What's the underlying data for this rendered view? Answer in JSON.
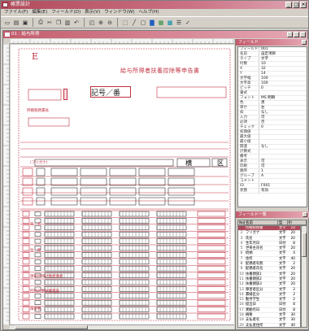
{
  "window": {
    "title": "帳票設計",
    "child_title": "01 : 給与所得"
  },
  "menu": [
    "ファイル(F)",
    "編集(E)",
    "フィールド(D)",
    "表示(V)",
    "ウィンドウ(W)",
    "ヘルプ(H)"
  ],
  "toolbar_icons": [
    "new-icon",
    "open-icon",
    "save-icon",
    "print-icon",
    "cut-icon",
    "copy-icon",
    "paste-icon",
    "undo-icon",
    "preview-icon",
    "zoom-in-icon",
    "zoom-out-icon",
    "field-icon",
    "line-icon",
    "box-icon",
    "text-icon",
    "grid-icon",
    "property-icon",
    "list-icon",
    "check-icon"
  ],
  "form": {
    "big_letter": "E",
    "title": "給与所得者扶養控除等申告書",
    "kanji_field": "記号／番",
    "label_left": "所轄税務署長",
    "row_labels": [
      "(フリガナ)",
      "氏　名",
      "住　所",
      "源泉控除対象配偶者",
      "控除対象扶養親族",
      "障害者"
    ],
    "thumb_chars": [
      "横",
      "区"
    ]
  },
  "properties": {
    "title": "フィールド",
    "rows": [
      {
        "k": "フィールド",
        "v": "001"
      },
      {
        "k": "名前",
        "v": "設定項目"
      },
      {
        "k": "タイプ",
        "v": "文字"
      },
      {
        "k": "桁数",
        "v": "10"
      },
      {
        "k": "X",
        "v": "32"
      },
      {
        "k": "Y",
        "v": "14"
      },
      {
        "k": "文字幅",
        "v": "100"
      },
      {
        "k": "文字高",
        "v": "100"
      },
      {
        "k": "ピッチ",
        "v": "0"
      },
      {
        "k": "書式",
        "v": ""
      },
      {
        "k": "フォント",
        "v": "MS 明朝"
      },
      {
        "k": "色",
        "v": "黒"
      },
      {
        "k": "寄せ",
        "v": "左"
      },
      {
        "k": "枠",
        "v": "なし"
      },
      {
        "k": "入力",
        "v": "可"
      },
      {
        "k": "必須",
        "v": "否"
      },
      {
        "k": "チェック",
        "v": "0"
      },
      {
        "k": "初期値",
        "v": ""
      },
      {
        "k": "最大値",
        "v": ""
      },
      {
        "k": "最小値",
        "v": ""
      },
      {
        "k": "関連",
        "v": "なし"
      },
      {
        "k": "計算式",
        "v": ""
      },
      {
        "k": "備考",
        "v": ""
      },
      {
        "k": "表示",
        "v": "可"
      },
      {
        "k": "印刷",
        "v": "可"
      },
      {
        "k": "順序",
        "v": "1"
      },
      {
        "k": "グループ",
        "v": "A"
      },
      {
        "k": "コメント",
        "v": ""
      },
      {
        "k": "ID",
        "v": "F001"
      },
      {
        "k": "状態",
        "v": "有効"
      }
    ]
  },
  "fieldlist": {
    "title": "フィールド一覧",
    "headers": [
      "No",
      "名前",
      "型",
      "桁"
    ],
    "rows": [
      {
        "n": "1",
        "name": "所轄税務署",
        "t": "文字",
        "w": "10"
      },
      {
        "n": "2",
        "name": "フリガナ",
        "t": "文字",
        "w": "20"
      },
      {
        "n": "3",
        "name": "氏名",
        "t": "文字",
        "w": "20"
      },
      {
        "n": "4",
        "name": "生年月日",
        "t": "日付",
        "w": "8"
      },
      {
        "n": "5",
        "name": "世帯主氏名",
        "t": "文字",
        "w": "20"
      },
      {
        "n": "6",
        "name": "続柄",
        "t": "文字",
        "w": "4"
      },
      {
        "n": "7",
        "name": "住所",
        "t": "文字",
        "w": "40"
      },
      {
        "n": "8",
        "name": "配偶者有無",
        "t": "文字",
        "w": "2"
      },
      {
        "n": "9",
        "name": "配偶者氏名",
        "t": "文字",
        "w": "20"
      },
      {
        "n": "10",
        "name": "扶養親族1",
        "t": "文字",
        "w": "20"
      },
      {
        "n": "11",
        "name": "扶養親族2",
        "t": "文字",
        "w": "20"
      },
      {
        "n": "12",
        "name": "扶養親族3",
        "t": "文字",
        "w": "20"
      },
      {
        "n": "13",
        "name": "障害者区分",
        "t": "文字",
        "w": "2"
      },
      {
        "n": "14",
        "name": "寡婦区分",
        "t": "文字",
        "w": "2"
      },
      {
        "n": "15",
        "name": "勤労学生",
        "t": "文字",
        "w": "2"
      },
      {
        "n": "16",
        "name": "提出日",
        "t": "日付",
        "w": "8"
      },
      {
        "n": "17",
        "name": "異動月日",
        "t": "日付",
        "w": "8"
      },
      {
        "n": "18",
        "name": "摘要",
        "t": "文字",
        "w": "30"
      },
      {
        "n": "19",
        "name": "支払者名",
        "t": "文字",
        "w": "30"
      },
      {
        "n": "20",
        "name": "支払者住所",
        "t": "文字",
        "w": "40"
      }
    ]
  }
}
